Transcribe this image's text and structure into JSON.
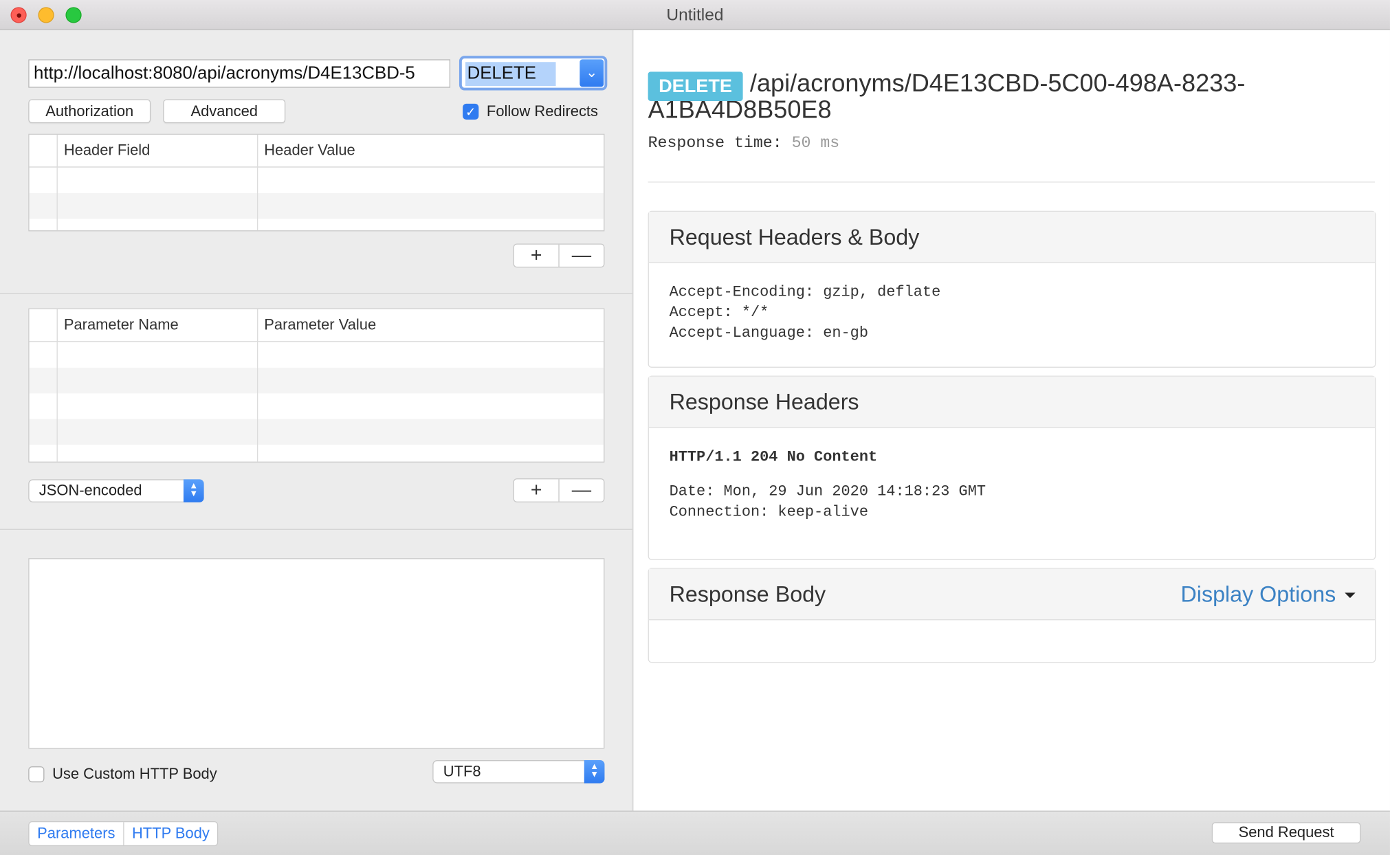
{
  "window": {
    "title": "Untitled"
  },
  "request": {
    "url": "http://localhost:8080/api/acronyms/D4E13CBD-5",
    "method": "DELETE",
    "authorization_label": "Authorization",
    "advanced_label": "Advanced",
    "follow_redirects_label": "Follow Redirects",
    "follow_redirects_checked": true
  },
  "headers_table": {
    "columns": [
      "Header Field",
      "Header Value"
    ],
    "add_symbol": "+",
    "remove_symbol": "—"
  },
  "params_table": {
    "columns": [
      "Parameter Name",
      "Parameter Value"
    ],
    "encoding": "JSON-encoded",
    "add_symbol": "+",
    "remove_symbol": "—"
  },
  "body": {
    "use_custom_label": "Use Custom HTTP Body",
    "use_custom_checked": false,
    "charset": "UTF8"
  },
  "bottom": {
    "tabs": [
      "Parameters",
      "HTTP Body"
    ],
    "send_label": "Send Request"
  },
  "response": {
    "method_badge": "DELETE",
    "path": "/api/acronyms/D4E13CBD-5C00-498A-8233-A1BA4D8B50E8",
    "time_label": "Response time:",
    "time_value": "50 ms",
    "request_section": {
      "title": "Request Headers & Body",
      "lines": [
        "Accept-Encoding: gzip, deflate",
        "Accept: */*",
        "Accept-Language: en-gb"
      ]
    },
    "headers_section": {
      "title": "Response Headers",
      "status_line": "HTTP/1.1 204 No Content",
      "lines": [
        "Date: Mon, 29 Jun 2020 14:18:23 GMT",
        "Connection: keep-alive"
      ]
    },
    "body_section": {
      "title": "Response Body",
      "display_options": "Display Options"
    }
  }
}
